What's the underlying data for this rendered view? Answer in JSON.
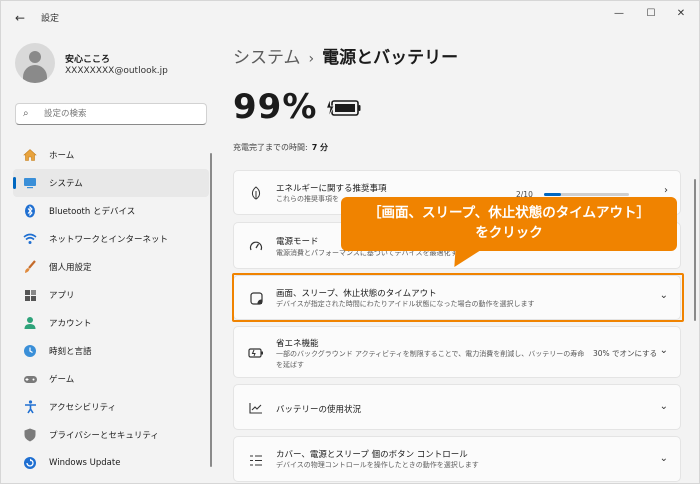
{
  "window": {
    "title": "設定",
    "back_icon": "back-arrow-icon",
    "controls": [
      "minimize-icon",
      "maximize-icon",
      "close-icon"
    ]
  },
  "user": {
    "name": "安心こころ",
    "email": "XXXXXXXX@outlook.jp"
  },
  "search": {
    "placeholder": "設定の検索"
  },
  "sidebar": {
    "items": [
      {
        "label": "ホーム",
        "icon": "home-icon"
      },
      {
        "label": "システム",
        "icon": "system-icon",
        "active": true
      },
      {
        "label": "Bluetooth とデバイス",
        "icon": "bluetooth-icon"
      },
      {
        "label": "ネットワークとインターネット",
        "icon": "wifi-icon"
      },
      {
        "label": "個人用設定",
        "icon": "brush-icon"
      },
      {
        "label": "アプリ",
        "icon": "apps-icon"
      },
      {
        "label": "アカウント",
        "icon": "account-icon"
      },
      {
        "label": "時刻と言語",
        "icon": "clock-globe-icon"
      },
      {
        "label": "ゲーム",
        "icon": "gamepad-icon"
      },
      {
        "label": "アクセシビリティ",
        "icon": "accessibility-icon"
      },
      {
        "label": "プライバシーとセキュリティ",
        "icon": "shield-icon"
      },
      {
        "label": "Windows Update",
        "icon": "update-icon"
      }
    ]
  },
  "breadcrumb": {
    "parent": "システム",
    "separator": "›",
    "current": "電源とバッテリー"
  },
  "battery": {
    "percent": "99%",
    "charge_label": "充電完了までの時間:",
    "charge_value": "7 分"
  },
  "cards": {
    "energy": {
      "title": "エネルギーに関する推奨事項",
      "desc": "これらの推奨事項を",
      "progress_text": "2/10",
      "progress_fraction": 0.2
    },
    "power_mode": {
      "title": "電源モード",
      "desc": "電源消費とパフォーマンスに基づいてデバイスを最適化する"
    },
    "screen_sleep": {
      "title": "画面、スリープ、休止状態のタイムアウト",
      "desc": "デバイスが指定された時間にわたりアイドル状態になった場合の動作を選択します"
    },
    "energy_saver": {
      "title": "省エネ機能",
      "desc1": "一部のバックグラウンド アクティビティを制限することで、電力消費を削減し、バッテリーの寿命",
      "desc2": "を延ばす",
      "status": "30% でオンにする"
    },
    "battery_usage": {
      "title": "バッテリーの使用状況"
    },
    "buttons": {
      "title": "カバー、電源とスリープ 個のボタン コントロール",
      "desc": "デバイスの物理コントロールを操作したときの動作を選択します"
    }
  },
  "callout": {
    "line1": "［画面、スリープ、休止状態のタイムアウト］",
    "line2": "をクリック",
    "color": "#f08300"
  },
  "colors": {
    "accent": "#0067c0",
    "highlight": "#f08300"
  }
}
